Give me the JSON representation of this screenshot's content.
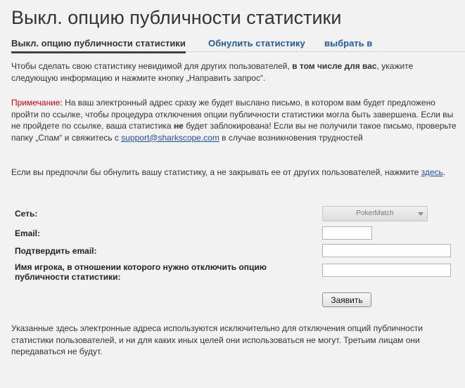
{
  "page": {
    "title": "Выкл. опцию публичности статистики"
  },
  "tabs": [
    {
      "label": "Выкл. опцию публичности статистики",
      "active": true
    },
    {
      "label": "Обнулить статистику",
      "active": false
    },
    {
      "label": "выбрать в",
      "active": false
    }
  ],
  "intro": {
    "part1": "Чтобы сделать свою статистику невидимой для других пользователей, ",
    "bold": "в том числе для вас",
    "part2": ", укажите следующую информацию и нажмите кнопку „Направить запрос“."
  },
  "note": {
    "label": "Примечание:",
    "part1": " На ваш электронный адрес сразу же будет выслано письмо, в котором вам будет предложено пройти по ссылке, чтобы процедура отключения опции публичности статистики могла быть завершена. Если вы не пройдете по ссылке, ваша статистика ",
    "bold": "не",
    "part2": " будет заблокирована! Если вы не получили такое письмо, проверьте папку „Спам“ и свяжитесь с ",
    "email": "support@sharkscope.com",
    "part3": " в случае возникновения трудностей"
  },
  "reset_note": {
    "text": "Если вы предпочли бы обнулить вашу статистику, а не закрывать ее от других пользователей, нажмите ",
    "link": "здесь",
    "end": "."
  },
  "form": {
    "network_label": "Сеть:",
    "network_value": "PokerMatch",
    "email_label": "Email:",
    "email_value": "",
    "confirm_email_label": "Подтвердить email:",
    "confirm_email_value": "",
    "player_label": "Имя игрока, в отношении которого нужно отключить опцию публичности статистики:",
    "player_value": "",
    "submit_label": "Заявить"
  },
  "footer": {
    "text": "Указанные здесь электронные адреса используются исключительно для отключения опций публичности статистики пользователей, и ни для каких иных целей они использоваться не могут. Третьим лицам они передаваться не будут."
  }
}
